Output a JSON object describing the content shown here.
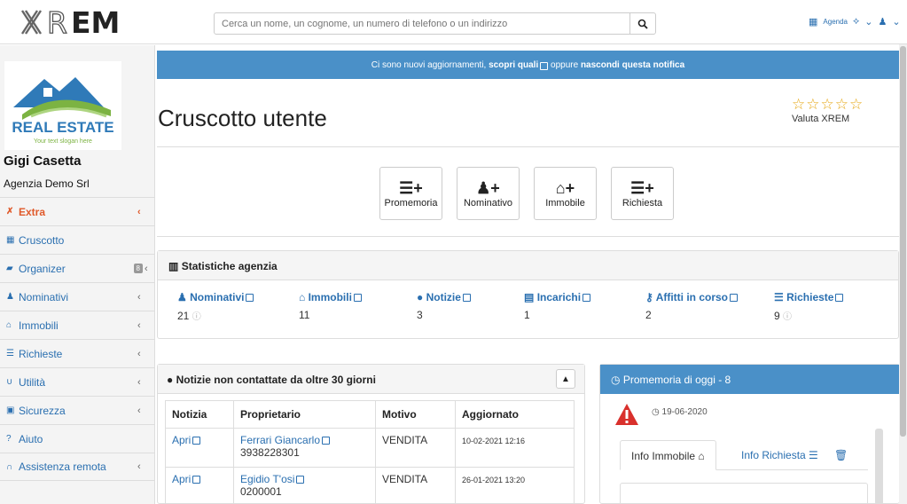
{
  "header": {
    "logo_text": "XREM",
    "search": {
      "placeholder": "Cerca un nome, un cognome, un numero di telefono o un indirizzo"
    },
    "agenda_label": "Agenda",
    "icons": [
      "calendar-icon",
      "search-icon",
      "chat-icon",
      "chevron-down-icon",
      "user-icon"
    ]
  },
  "sidebar": {
    "brand_title": "REAL ESTATE",
    "brand_slogan": "Your text slogan here",
    "user_name": "Gigi Casetta",
    "agency": "Agenzia Demo Srl",
    "items": [
      {
        "label": "Extra",
        "icon": "close-icon",
        "chevron": "‹",
        "color": "#e05a2b"
      },
      {
        "label": "Cruscotto",
        "icon": "table-icon",
        "chevron": ""
      },
      {
        "label": "Organizer",
        "icon": "folder-icon",
        "chevron": "‹",
        "badge": "8"
      },
      {
        "label": "Nominativi",
        "icon": "user-icon",
        "chevron": "‹"
      },
      {
        "label": "Immobili",
        "icon": "home-icon",
        "chevron": "‹"
      },
      {
        "label": "Richieste",
        "icon": "list-icon",
        "chevron": "‹"
      },
      {
        "label": "Utilità",
        "icon": "magnet-icon",
        "chevron": "‹"
      },
      {
        "label": "Sicurezza",
        "icon": "lock-icon",
        "chevron": "‹"
      },
      {
        "label": "Aiuto",
        "icon": "question-icon",
        "chevron": ""
      },
      {
        "label": "Assistenza remota",
        "icon": "headset-icon",
        "chevron": "‹"
      }
    ]
  },
  "notice": {
    "text1": "Ci sono nuovi aggiornamenti,",
    "link1": "scopri quali",
    "text2": "oppure",
    "link2": "nascondi questa notifica"
  },
  "page": {
    "title": "Cruscotto utente",
    "rating_label": "Valuta XREM",
    "stars": "☆☆☆☆☆"
  },
  "quick_actions": [
    {
      "label": "Promemoria",
      "icon": "ordered-list-plus-icon"
    },
    {
      "label": "Nominativo",
      "icon": "user-plus-icon"
    },
    {
      "label": "Immobile",
      "icon": "home-plus-icon"
    },
    {
      "label": "Richiesta",
      "icon": "list-plus-icon"
    }
  ],
  "stats": {
    "title": "Statistiche agenzia",
    "items": [
      {
        "label": "Nominativi",
        "value": "21"
      },
      {
        "label": "Immobili",
        "value": "11"
      },
      {
        "label": "Notizie",
        "value": "3"
      },
      {
        "label": "Incarichi",
        "value": "1"
      },
      {
        "label": "Affitti in corso",
        "value": "2"
      },
      {
        "label": "Richieste",
        "value": "9"
      }
    ]
  },
  "notizie": {
    "title": "Notizie non contattate da oltre 30 giorni",
    "columns": [
      "Notizia",
      "Proprietario",
      "Motivo",
      "Aggiornato"
    ],
    "rows": [
      {
        "link": "Apri",
        "owner": "Ferrari Giancarlo",
        "phone": "3938228301",
        "reason": "VENDITA",
        "updated": "10-02-2021 12:16"
      },
      {
        "link": "Apri",
        "owner": "Egidio T'osi",
        "phone": "0200001",
        "reason": "VENDITA",
        "updated": "26-01-2021 13:20"
      }
    ]
  },
  "promemoria": {
    "title": "Promemoria di oggi - 8",
    "date": "19-06-2020",
    "tabs": [
      "Info Immobile",
      "Info Richiesta"
    ]
  },
  "colors": {
    "primary": "#2a6fb0",
    "notice_bg": "#4a90c8",
    "star": "#e6a817",
    "warning": "#d9302c",
    "extra": "#e05a2b"
  }
}
